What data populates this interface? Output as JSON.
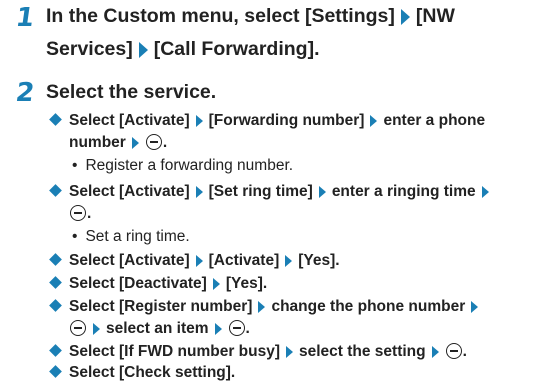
{
  "step1": {
    "num": "1",
    "line1": "In the Custom menu, select [Settings]",
    "line1b": "[NW",
    "line2a": "Services]",
    "line2b": "[Call Forwarding]."
  },
  "step2": {
    "num": "2",
    "title": "Select the service."
  },
  "items": {
    "i1_a": "Select [Activate]",
    "i1_b": "[Forwarding number]",
    "i1_c": "enter a phone",
    "i1_d": "number",
    "i1_e": ".",
    "i1_note": "Register a forwarding number.",
    "i2_a": "Select [Activate]",
    "i2_b": "[Set ring time]",
    "i2_c": "enter a ringing time",
    "i2_e": ".",
    "i2_note": "Set a ring time.",
    "i3_a": "Select [Activate]",
    "i3_b": "[Activate]",
    "i3_c": "[Yes].",
    "i4_a": "Select [Deactivate]",
    "i4_b": "[Yes].",
    "i5_a": "Select [Register number]",
    "i5_b": "change the phone number",
    "i5_c": "select an item",
    "i5_e": ".",
    "i6_a": "Select [If FWD number busy]",
    "i6_b": "select the setting",
    "i6_e": ".",
    "i7_a": "Select [Check setting]."
  },
  "icons": {
    "arrow": "triangle-right-icon",
    "key": "center-key-icon",
    "diamond": "diamond-bullet-icon",
    "accent_color": "#1a7fb5"
  }
}
